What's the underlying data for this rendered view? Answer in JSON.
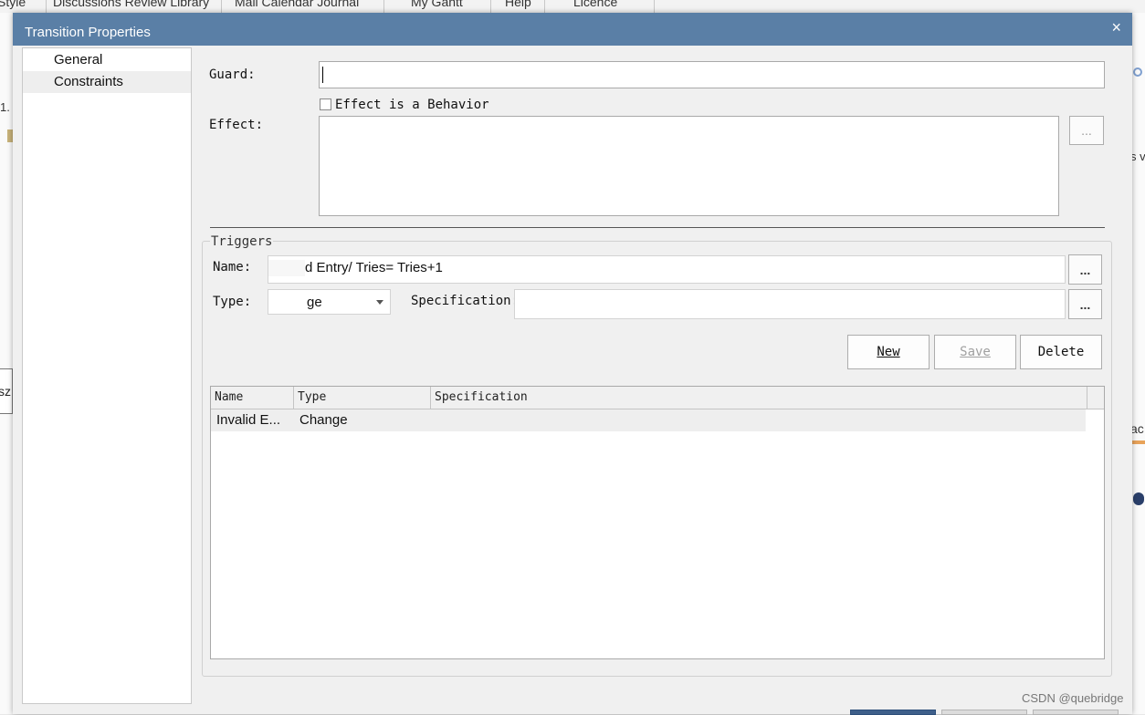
{
  "background": {
    "tabs": [
      "Style",
      "Discussions Review Library",
      "Mail Calendar Journal",
      "My Gantt",
      "Help",
      "Licence"
    ],
    "fragment_left_1": "1.",
    "fragment_left_2": "sz",
    "fragment_right_1": "s v",
    "fragment_right_2": "ac"
  },
  "dialog": {
    "title": "Transition Properties",
    "close_glyph": "×"
  },
  "nav": {
    "items": [
      {
        "label": "General",
        "selected": false
      },
      {
        "label": "Constraints",
        "selected": true
      }
    ]
  },
  "form": {
    "guard_label": "Guard:",
    "guard_value": "",
    "effect_checkbox_label": "Effect is a Behavior",
    "effect_label": "Effect:",
    "effect_value": "",
    "ellipsis": "..."
  },
  "triggers": {
    "group_title": "Triggers",
    "name_label": "Name:",
    "name_value": "d Entry/ Tries= Tries+1",
    "type_label": "Type:",
    "type_value": "ge",
    "spec_label": "Specification:",
    "spec_value": "",
    "buttons": {
      "new": "New",
      "save": "Save",
      "delete": "Delete"
    },
    "table": {
      "columns": [
        "Name",
        "Type",
        "Specification"
      ],
      "rows": [
        {
          "name": "Invalid E...",
          "type": "Change",
          "spec": ""
        }
      ]
    }
  },
  "watermark": "CSDN @quebridge",
  "colors": {
    "titlebar": "#5a7fa6",
    "dialog_bg": "#f0f0f0"
  }
}
